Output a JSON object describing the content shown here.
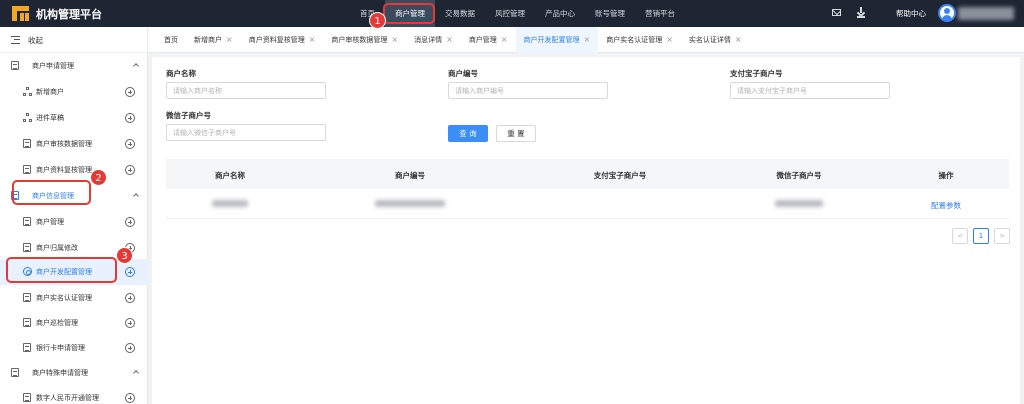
{
  "app": {
    "title": "机构管理平台"
  },
  "topnav": {
    "items": [
      "首页",
      "商户管理",
      "交易数据",
      "风控管理",
      "产品中心",
      "账号管理",
      "营销平台"
    ],
    "active_index": 1,
    "help_label": "帮助中心"
  },
  "sidebar": {
    "collapse_label": "收起",
    "groups": [
      {
        "label": "商户申请管理",
        "children": [
          "新增商户",
          "进件草稿",
          "商户审核数据管理",
          "商户资料复核管理"
        ]
      },
      {
        "label": "商户信息管理",
        "children": [
          "商户管理",
          "商户归属修改",
          "商户开发配置管理",
          "商户实名认证管理",
          "商户巡检管理",
          "银行卡申请管理"
        ]
      },
      {
        "label": "商户特殊申请管理",
        "children": [
          "数字人民币开通管理"
        ]
      }
    ],
    "selected_item": "商户开发配置管理"
  },
  "tabs": {
    "items": [
      "首页",
      "新增商户",
      "商户资料复核管理",
      "商户审核数据管理",
      "消息详情",
      "商户管理",
      "商户开发配置管理",
      "商户实名认证管理",
      "实名认证详情"
    ],
    "active_index": 6,
    "close_symbol": "×"
  },
  "filters": {
    "merchant_name": {
      "label": "商户名称",
      "placeholder": "请输入商户名称"
    },
    "merchant_no": {
      "label": "商户编号",
      "placeholder": "请输入商户编号"
    },
    "alipay_sub_no": {
      "label": "支付宝子商户号",
      "placeholder": "请输入支付宝子商户号"
    },
    "wechat_sub_no": {
      "label": "微信子商户号",
      "placeholder": "请输入微信子商户号"
    },
    "query_button": "查 询",
    "reset_button": "重 置"
  },
  "table": {
    "columns": [
      "商户名称",
      "商户编号",
      "支付宝子商户号",
      "微信子商户号",
      "操作"
    ],
    "rows": [
      {
        "action": "配置参数"
      }
    ]
  },
  "pagination": {
    "current_page": "1",
    "prev": "<",
    "next": ">"
  },
  "annotations": [
    "1",
    "2",
    "3"
  ],
  "colors": {
    "topbar": "#1f2633",
    "accent": "#2e7ff0",
    "callout": "#e53935",
    "logo": "#f5a623"
  }
}
